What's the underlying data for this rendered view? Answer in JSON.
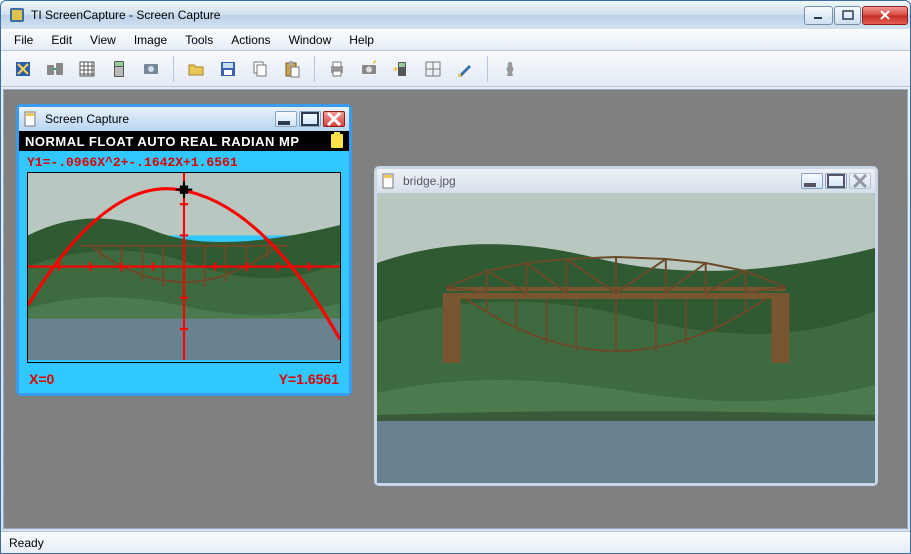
{
  "window": {
    "title": "TI ScreenCapture - Screen Capture"
  },
  "menubar": [
    "File",
    "Edit",
    "View",
    "Image",
    "Tools",
    "Actions",
    "Window",
    "Help"
  ],
  "toolbar_icons": [
    "device-explorer-icon",
    "transfer-icon",
    "data-table-icon",
    "calculator-icon",
    "screenshot-icon",
    "sep",
    "open-folder-icon",
    "save-icon",
    "copy-icon",
    "paste-icon",
    "sep",
    "print-icon",
    "camera-icon",
    "send-to-device-icon",
    "crosshair-icon",
    "pen-icon",
    "sep",
    "chess-piece-icon"
  ],
  "children": {
    "calc": {
      "title": "Screen Capture",
      "status_line": "NORMAL FLOAT AUTO REAL RADIAN MP",
      "equation": "Y1=-.0966X^2+-.1642X+1.6561",
      "x_readout": "X=0",
      "y_readout": "Y=1.6561"
    },
    "bridge": {
      "title": "bridge.jpg"
    }
  },
  "status": "Ready",
  "chart_data": {
    "type": "line",
    "title": "Parabola overlay on bridge arch",
    "series": [
      {
        "name": "Y1",
        "expression": "-0.0966*x^2 - 0.1642*x + 1.6561"
      }
    ],
    "cursor": {
      "x": 0,
      "y": 1.6561
    },
    "xlabel": "X",
    "ylabel": "Y",
    "xlim": [
      -5,
      5
    ],
    "ylim": [
      -2,
      2
    ],
    "annotations": [
      "X=0",
      "Y=1.6561"
    ]
  }
}
